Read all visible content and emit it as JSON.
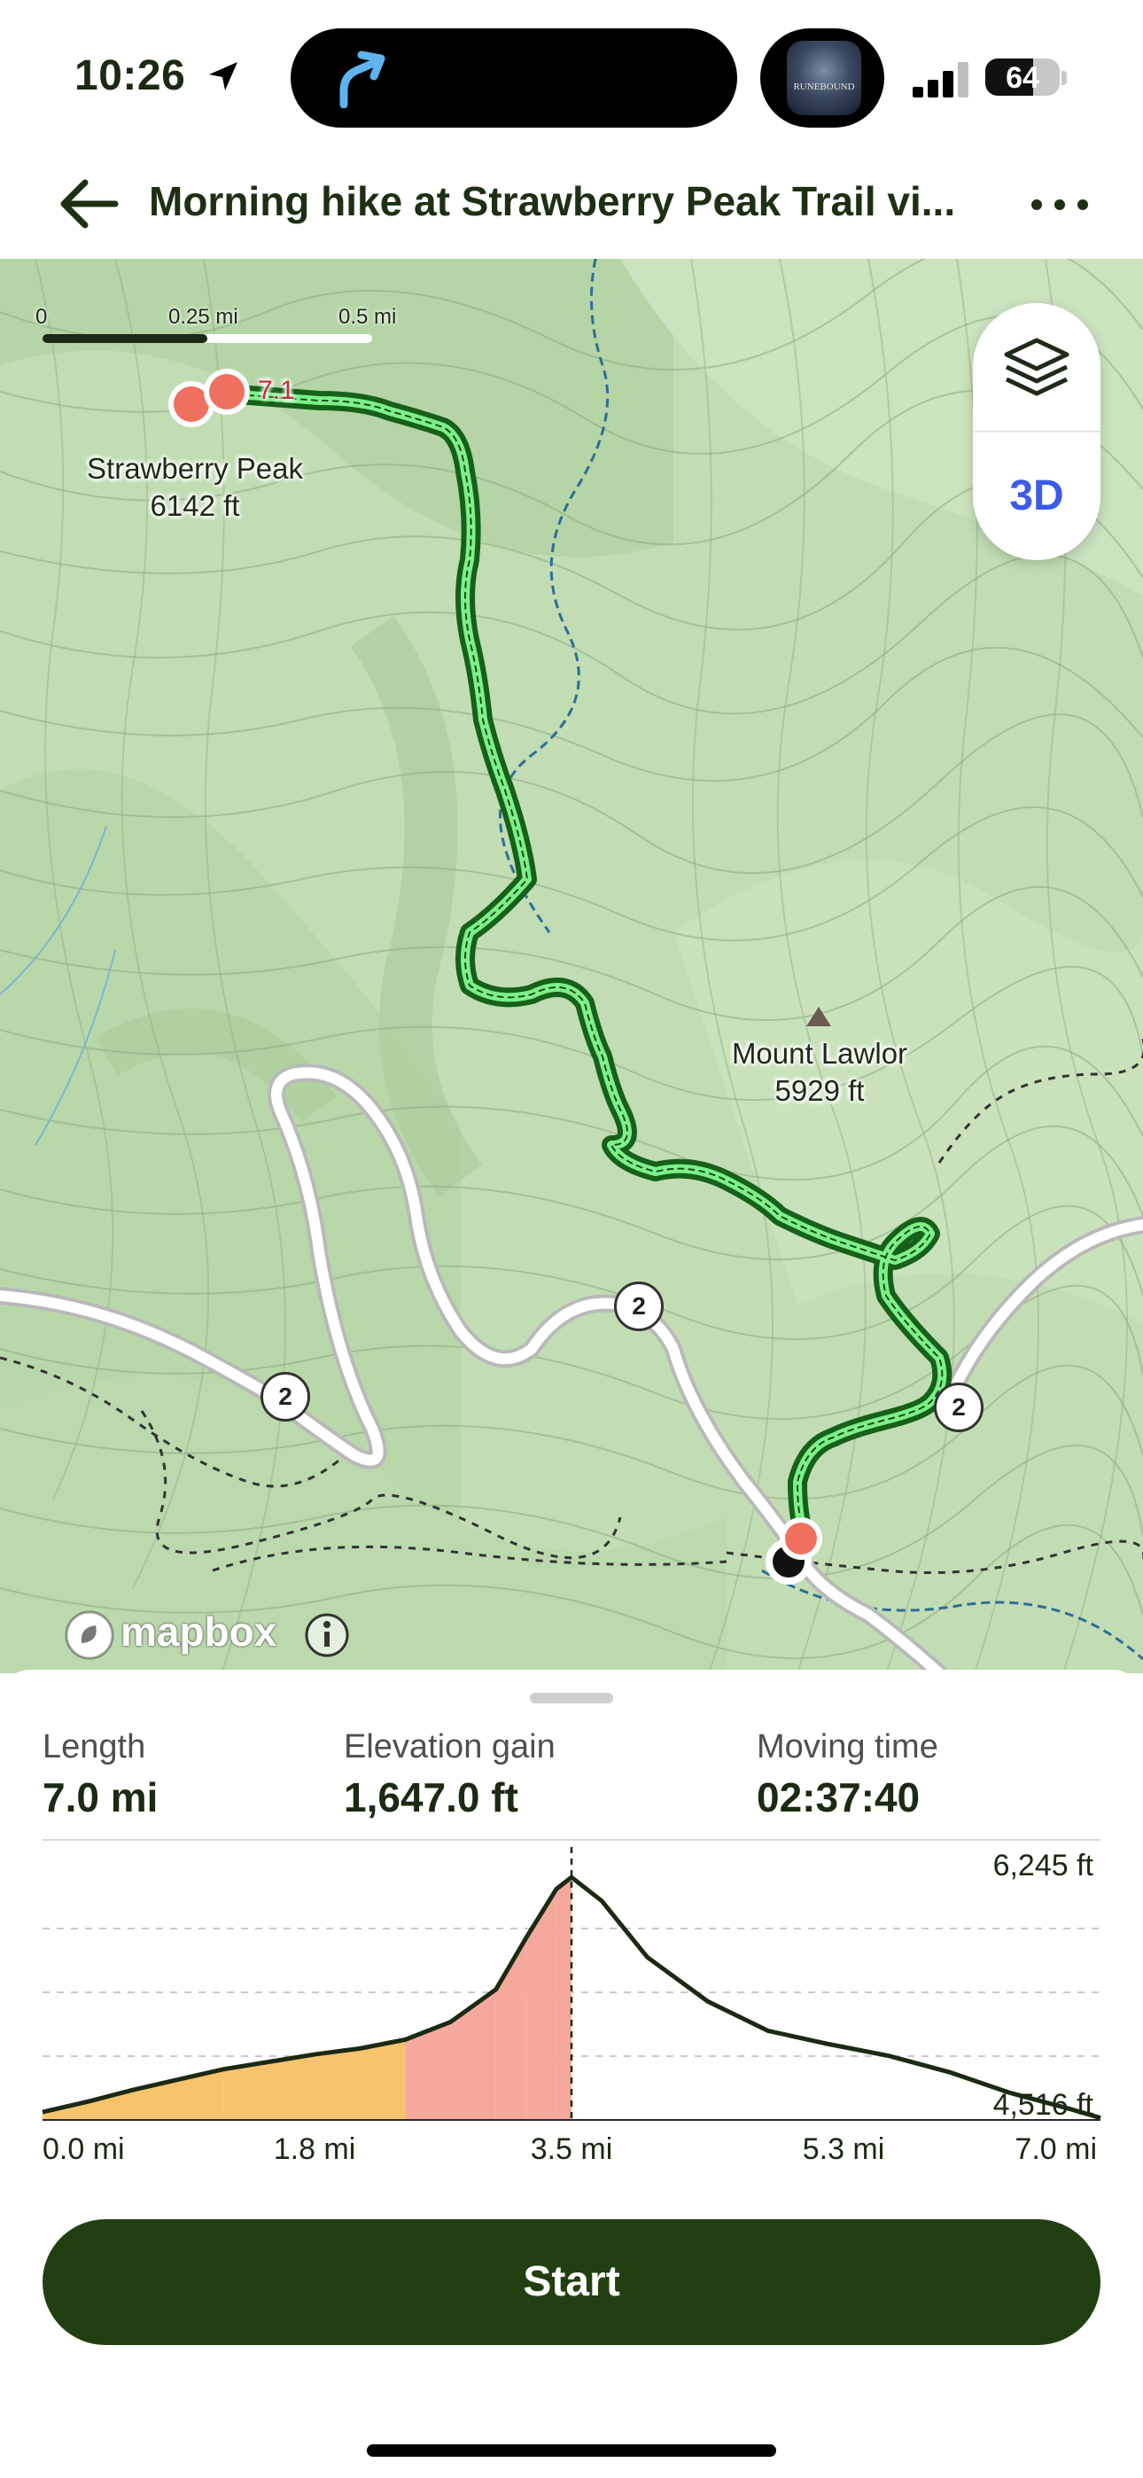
{
  "status_bar": {
    "time": "10:26",
    "battery": "64",
    "battery_level": 0.64,
    "icons": [
      "location-arrow-icon",
      "navigation-arrow-icon",
      "app-thumbnail",
      "cellular-signal-icon",
      "battery-icon"
    ],
    "app_thumb_text": "RUNEBOUND"
  },
  "header": {
    "title": "Morning hike at Strawberry Peak Trail vi...",
    "back_icon": "arrow-left-icon",
    "more_icon": "more-dots-icon"
  },
  "map": {
    "scale": {
      "labels": [
        "0",
        "0.25 mi",
        "0.5 mi"
      ]
    },
    "peaks": [
      {
        "name": "Strawberry Peak",
        "elevation": "6142 ft"
      },
      {
        "name": "Mount Lawlor",
        "elevation": "5929 ft"
      }
    ],
    "route_end_label": "7.1",
    "road_badges": [
      "2",
      "2",
      "2"
    ],
    "controls": {
      "layers_icon": "layers-icon",
      "mode_3d": "3D"
    },
    "attribution": "mapbox",
    "info_icon": "info-icon",
    "colors": {
      "route": "#1f7a1a",
      "route_fill": "#7df08a",
      "marker": "#f07060",
      "water": "#2d6e98"
    }
  },
  "stats": [
    {
      "label": "Length",
      "value": "7.0 mi"
    },
    {
      "label": "Elevation gain",
      "value": "1,647.0 ft"
    },
    {
      "label": "Moving time",
      "value": "02:37:40"
    }
  ],
  "chart_data": {
    "type": "area",
    "x": [
      0.0,
      0.3,
      0.6,
      0.9,
      1.2,
      1.5,
      1.8,
      2.1,
      2.4,
      2.7,
      3.0,
      3.2,
      3.4,
      3.5,
      3.7,
      4.0,
      4.4,
      4.8,
      5.2,
      5.6,
      6.0,
      6.4,
      6.8,
      7.0
    ],
    "y": [
      4570,
      4640,
      4720,
      4790,
      4860,
      4910,
      4960,
      5000,
      5060,
      5180,
      5400,
      5750,
      6080,
      6160,
      6000,
      5620,
      5320,
      5120,
      5030,
      4950,
      4840,
      4700,
      4590,
      4530
    ],
    "x_tick_labels": [
      "0.0 mi",
      "1.8 mi",
      "3.5 mi",
      "5.3 mi",
      "7.0 mi"
    ],
    "y_tick_labels": [
      "6,245 ft",
      "4,516 ft"
    ],
    "xlim": [
      0,
      7.0
    ],
    "ylim": [
      4516,
      6245
    ],
    "cursor_x": 3.5,
    "grid": "dashed horizontal",
    "colors": {
      "line": "#1b2a12",
      "fill_gentle": "#f7c36d",
      "fill_steep": "#f5a99d"
    }
  },
  "actions": {
    "start": "Start"
  }
}
